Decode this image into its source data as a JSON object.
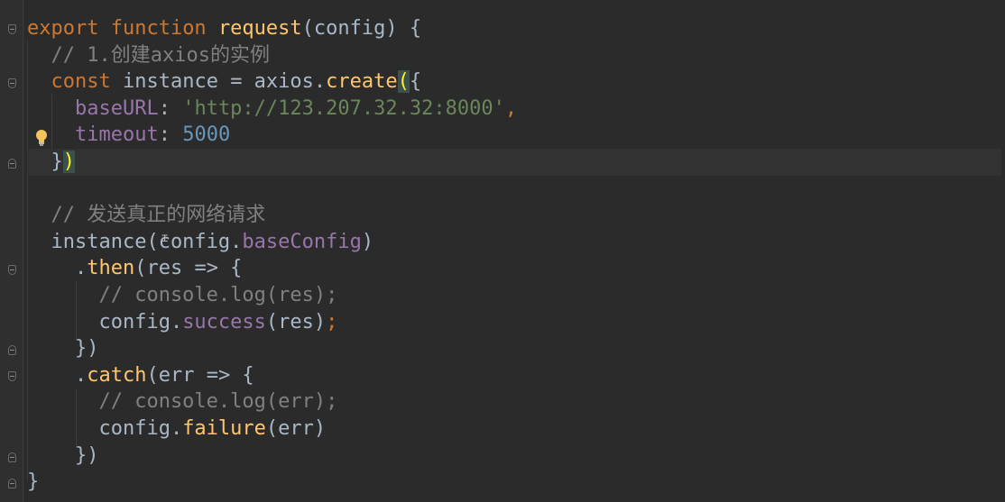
{
  "editor": {
    "lines": [
      {
        "segments": [
          {
            "t": "export ",
            "c": "k"
          },
          {
            "t": "function ",
            "c": "k"
          },
          {
            "t": "request",
            "c": "f"
          },
          {
            "t": "(config) {",
            "c": "m"
          }
        ]
      },
      {
        "segments": [
          {
            "t": "  // 1.创建axios的实例",
            "c": "c"
          }
        ]
      },
      {
        "segments": [
          {
            "t": "  ",
            "c": "m"
          },
          {
            "t": "const ",
            "c": "k"
          },
          {
            "t": "instance = axios.",
            "c": "m"
          },
          {
            "t": "create",
            "c": "f"
          },
          {
            "t": "(",
            "c": "bm"
          },
          {
            "t": "{",
            "c": "m"
          }
        ]
      },
      {
        "segments": [
          {
            "t": "    ",
            "c": "m"
          },
          {
            "t": "baseURL",
            "c": "p"
          },
          {
            "t": ": ",
            "c": "m"
          },
          {
            "t": "'http://123.207.32.32:8000'",
            "c": "s"
          },
          {
            "t": ",",
            "c": "k"
          }
        ]
      },
      {
        "segments": [
          {
            "t": "    ",
            "c": "m"
          },
          {
            "t": "timeout",
            "c": "p"
          },
          {
            "t": ": ",
            "c": "m"
          },
          {
            "t": "5000",
            "c": "n"
          }
        ]
      },
      {
        "current": true,
        "segments": [
          {
            "t": "  }",
            "c": "m"
          },
          {
            "t": ")",
            "c": "bm"
          }
        ]
      },
      {
        "segments": [
          {
            "t": "",
            "c": "m"
          }
        ]
      },
      {
        "segments": [
          {
            "t": "  // 发送真正的网络请求",
            "c": "c"
          }
        ]
      },
      {
        "segments": [
          {
            "t": "  instance(config.",
            "c": "m"
          },
          {
            "t": "baseConfig",
            "c": "p"
          },
          {
            "t": ")",
            "c": "m"
          }
        ]
      },
      {
        "segments": [
          {
            "t": "    .",
            "c": "m"
          },
          {
            "t": "then",
            "c": "f"
          },
          {
            "t": "(res => {",
            "c": "m"
          }
        ]
      },
      {
        "segments": [
          {
            "t": "      // console.log(res);",
            "c": "c"
          }
        ]
      },
      {
        "segments": [
          {
            "t": "      config.",
            "c": "m"
          },
          {
            "t": "success",
            "c": "p"
          },
          {
            "t": "(res)",
            "c": "m"
          },
          {
            "t": ";",
            "c": "k"
          }
        ]
      },
      {
        "segments": [
          {
            "t": "    })",
            "c": "m"
          }
        ]
      },
      {
        "segments": [
          {
            "t": "    .",
            "c": "m"
          },
          {
            "t": "catch",
            "c": "f"
          },
          {
            "t": "(err => {",
            "c": "m"
          }
        ]
      },
      {
        "segments": [
          {
            "t": "      // console.log(err);",
            "c": "c"
          }
        ]
      },
      {
        "segments": [
          {
            "t": "      config.",
            "c": "m"
          },
          {
            "t": "failure",
            "c": "f"
          },
          {
            "t": "(err)",
            "c": "m"
          }
        ]
      },
      {
        "segments": [
          {
            "t": "    })",
            "c": "m"
          }
        ]
      },
      {
        "segments": [
          {
            "t": "}",
            "c": "m"
          }
        ]
      }
    ]
  },
  "gutter": {
    "fold_icons": [
      "fold-open-icon",
      "fold-open-icon",
      "fold-end-icon",
      "fold-open-icon",
      "fold-end-icon",
      "fold-open-icon",
      "fold-end-icon",
      "fold-end-icon"
    ],
    "bulb_icon": "lightbulb-icon"
  },
  "colors": {
    "background": "#2b2b2b",
    "keyword": "#cc7832",
    "function": "#ffc66d",
    "string": "#6a8759",
    "number": "#6897bb",
    "property": "#9876aa",
    "comment": "#808080",
    "text": "#a9b7c6",
    "bracket_match": "#3b514d"
  }
}
